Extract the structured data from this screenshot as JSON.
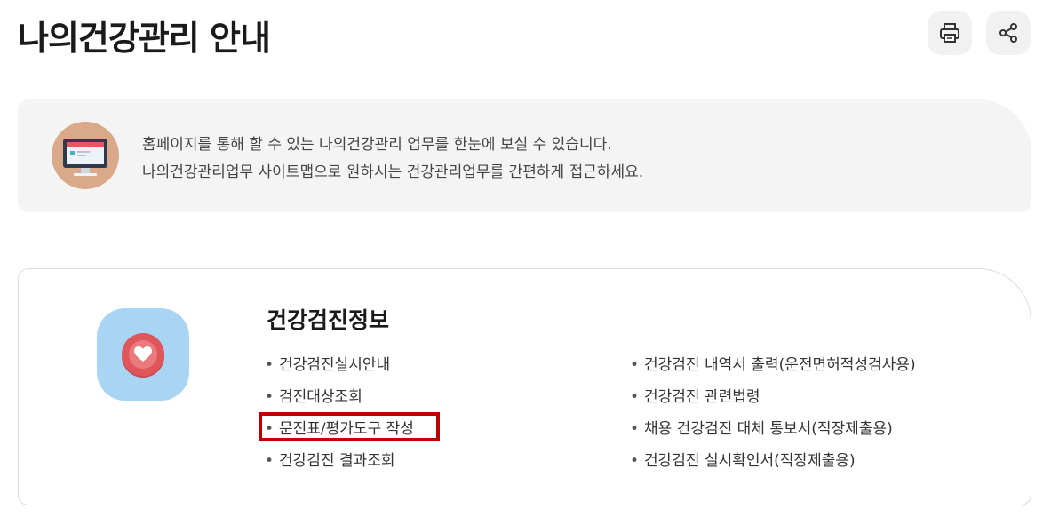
{
  "header": {
    "title": "나의건강관리 안내",
    "print_icon": "print-icon",
    "share_icon": "share-icon"
  },
  "intro": {
    "icon": "monitor-icon",
    "lines": [
      "홈페이지를 통해 할 수 있는 나의건강관리 업무를 한눈에 보실 수 있습니다.",
      "나의건강관리업무 사이트맵으로 원하시는 건강관리업무를 간편하게 접근하세요."
    ]
  },
  "section": {
    "icon": "heart-icon",
    "title": "건강검진정보",
    "bullet": "•",
    "col_1": [
      "건강검진실시안내",
      "검진대상조회",
      "문진표/평가도구 작성",
      "건강검진 결과조회"
    ],
    "col_2": [
      "건강검진 내역서 출력(운전면허적성검사용)",
      "건강검진 관련법령",
      "채용 건강검진 대체 통보서(직장제출용)",
      "건강검진 실시확인서(직장제출용)"
    ]
  },
  "colors": {
    "intro_bg": "#f4f4f4",
    "card_icon_bg": "#a9d5f5",
    "heart": "#e0575b",
    "highlight": "#c00000"
  }
}
